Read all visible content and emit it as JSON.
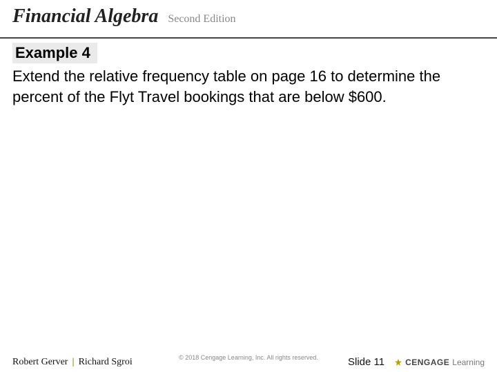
{
  "header": {
    "title": "Financial Algebra",
    "edition": "Second Edition"
  },
  "example": {
    "label": "Example 4",
    "text": "Extend the relative frequency table on page 16 to determine the percent of the Flyt Travel bookings that are below $600."
  },
  "footer": {
    "author1": "Robert Gerver",
    "author2": "Richard Sgroi",
    "copyright": "© 2018 Cengage Learning, Inc. All rights reserved.",
    "slide_label": "Slide 11",
    "publisher_a": "CENGAGE",
    "publisher_b": "Learning"
  }
}
